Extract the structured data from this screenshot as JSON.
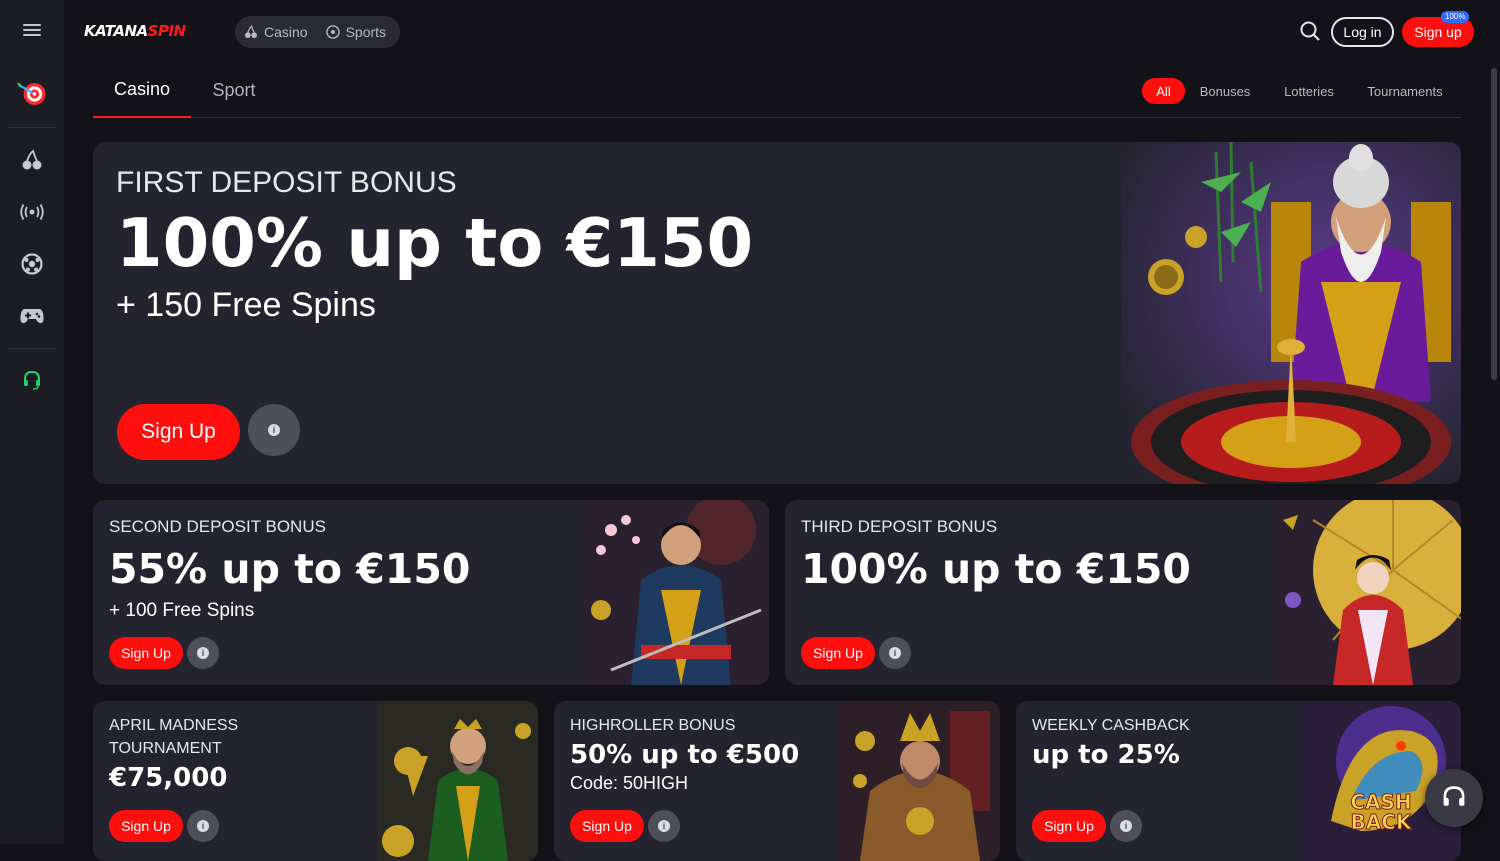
{
  "brand": {
    "logo_part1": "KATANA",
    "logo_part2": "SPIN"
  },
  "topnav": {
    "casino": "Casino",
    "sports": "Sports",
    "login": "Log in",
    "signup": "Sign up",
    "signup_badge": "100%"
  },
  "tabs": {
    "casino": "Casino",
    "sport": "Sport"
  },
  "filters": {
    "all": "All",
    "bonuses": "Bonuses",
    "lotteries": "Lotteries",
    "tournaments": "Tournaments"
  },
  "sidebar": {
    "icons": [
      "menu-icon",
      "target-icon",
      "cherry-icon",
      "live-icon",
      "soccer-ball-icon",
      "gamepad-icon",
      "headset-icon"
    ]
  },
  "hero": {
    "title": "FIRST DEPOSIT BONUS",
    "amount": "100% up to €150",
    "extra": "+ 150 Free Spins",
    "button": "Sign Up"
  },
  "cards": [
    {
      "title": "SECOND DEPOSIT BONUS",
      "amount": "55% up to €150",
      "extra": "+ 100 Free Spins",
      "button": "Sign Up"
    },
    {
      "title": "THIRD DEPOSIT BONUS",
      "amount": "100% up to €150",
      "extra": "",
      "button": "Sign Up"
    },
    {
      "title1": "APRIL MADNESS",
      "title2": "TOURNAMENT",
      "amount": "€75,000",
      "button": "Sign Up"
    },
    {
      "title": "HIGHROLLER BONUS",
      "amount": "50% up to €500",
      "extra": "Code: 50HIGH",
      "button": "Sign Up"
    },
    {
      "title": "WEEKLY CASHBACK",
      "amount": "up to 25%",
      "button": "Sign Up",
      "art_label1": "CASH",
      "art_label2": "BACK"
    }
  ],
  "colors": {
    "accent": "#ff0e0e",
    "background": "#121218",
    "card": "#242430",
    "sidebar": "#1c1c24"
  }
}
